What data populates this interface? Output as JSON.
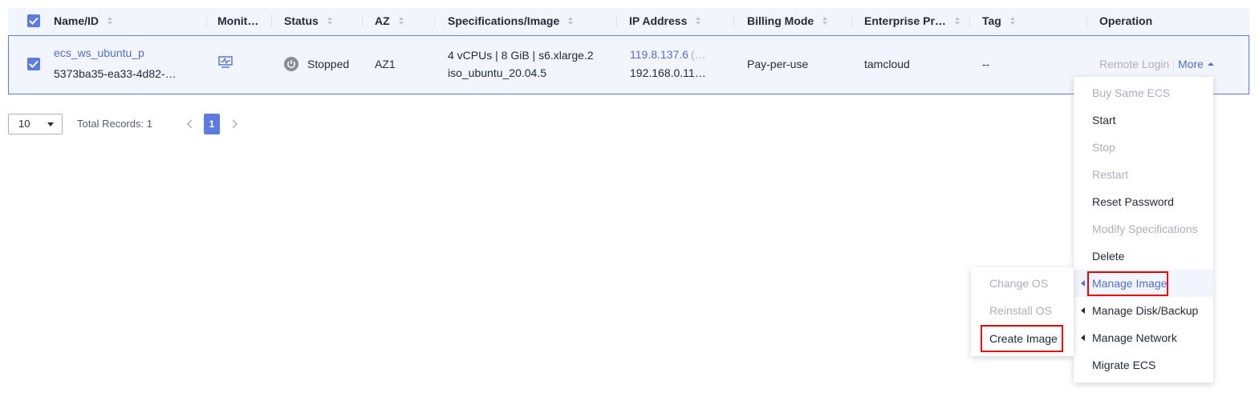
{
  "table": {
    "header_checked": true,
    "columns": {
      "name": "Name/ID",
      "monitoring": "Monit…",
      "status": "Status",
      "az": "AZ",
      "specs": "Specifications/Image",
      "ip": "IP Address",
      "billing": "Billing Mode",
      "enterprise": "Enterprise Pr…",
      "tag": "Tag",
      "operation": "Operation"
    },
    "rows": [
      {
        "checked": true,
        "name": "ecs_ws_ubuntu_p",
        "id": "5373ba35-ea33-4d82-…",
        "monitoring_icon": "monitor-chart-icon",
        "status_icon": "power-off-icon",
        "status": "Stopped",
        "az": "AZ1",
        "spec": "4 vCPUs | 8 GiB | s6.xlarge.2",
        "image": "iso_ubuntu_20.04.5",
        "eip": "119.8.137.6",
        "eip_suffix": "(…",
        "private_ip": "192.168.0.11…",
        "billing": "Pay-per-use",
        "enterprise": "tamcloud",
        "tag": "--",
        "op_remote_login": "Remote Login",
        "op_more": "More"
      }
    ]
  },
  "pagination": {
    "page_size": "10",
    "total": "Total Records: 1",
    "current_page": "1"
  },
  "more_menu": {
    "items": [
      {
        "label": "Buy Same ECS",
        "disabled": true
      },
      {
        "label": "Start",
        "disabled": false
      },
      {
        "label": "Stop",
        "disabled": true
      },
      {
        "label": "Restart",
        "disabled": true
      },
      {
        "label": "Reset Password",
        "disabled": false
      },
      {
        "label": "Modify Specifications",
        "disabled": true
      },
      {
        "label": "Delete",
        "disabled": false
      },
      {
        "label": "Manage Image",
        "disabled": false,
        "submenu": true,
        "active": true
      },
      {
        "label": "Manage Disk/Backup",
        "disabled": false,
        "submenu": true
      },
      {
        "label": "Manage Network",
        "disabled": false,
        "submenu": true
      },
      {
        "label": "Migrate ECS",
        "disabled": false
      }
    ]
  },
  "image_submenu": {
    "items": [
      {
        "label": "Change OS",
        "disabled": true
      },
      {
        "label": "Reinstall OS",
        "disabled": true
      },
      {
        "label": "Create Image",
        "disabled": false
      }
    ]
  },
  "colors": {
    "accent": "#5e7ce0",
    "link": "#526ecc",
    "header_bg": "#f2f5fc",
    "highlight_box": "#e00000",
    "disabled_text": "#adb0b8"
  }
}
